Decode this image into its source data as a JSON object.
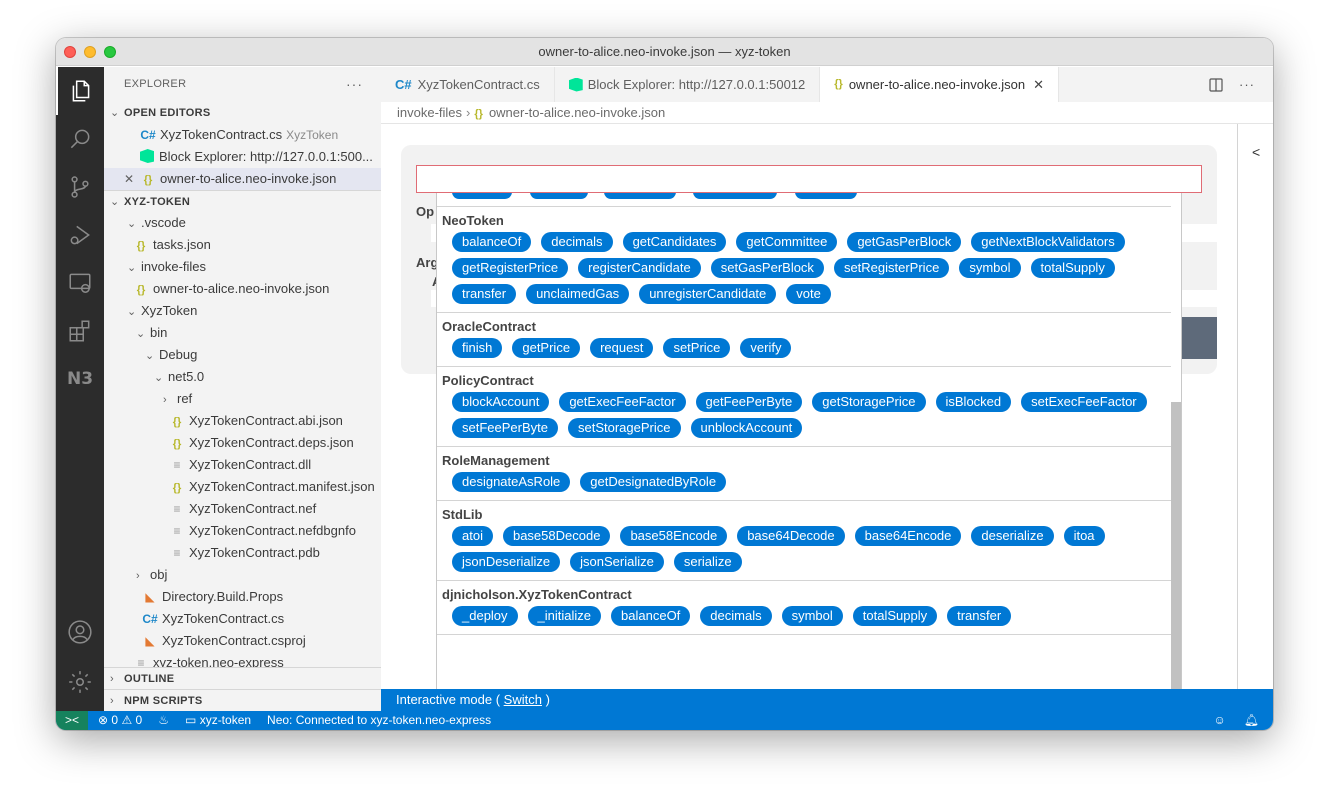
{
  "window": {
    "title": "owner-to-alice.neo-invoke.json — xyz-token"
  },
  "activity_bar": {
    "items": [
      {
        "name": "explorer",
        "icon": "files-icon",
        "active": true
      },
      {
        "name": "search",
        "icon": "search-icon"
      },
      {
        "name": "source-control",
        "icon": "source-control-icon"
      },
      {
        "name": "run-debug",
        "icon": "run-debug-icon"
      },
      {
        "name": "remote-explorer",
        "icon": "remote-explorer-icon"
      },
      {
        "name": "extensions",
        "icon": "extensions-icon"
      },
      {
        "name": "neo-n3",
        "icon": "n3-icon",
        "label": "N3"
      }
    ],
    "bottom": [
      {
        "name": "accounts",
        "icon": "account-icon"
      },
      {
        "name": "manage",
        "icon": "gear-icon"
      }
    ]
  },
  "sidebar": {
    "title": "EXPLORER",
    "more": "···",
    "open_editors": {
      "label": "OPEN EDITORS",
      "items": [
        {
          "icon": "csharp-icon",
          "name": "XyzTokenContract.cs",
          "desc": "XyzToken"
        },
        {
          "icon": "neo-icon",
          "name": "Block Explorer: http://127.0.0.1:500..."
        },
        {
          "icon": "json-icon",
          "name": "owner-to-alice.neo-invoke.json",
          "selected": true
        }
      ]
    },
    "workspace": {
      "label": "XYZ-TOKEN",
      "items": [
        {
          "depth": 1,
          "type": "folder",
          "open": true,
          "name": ".vscode"
        },
        {
          "depth": 1,
          "type": "json",
          "name": "tasks.json"
        },
        {
          "depth": 1,
          "type": "folder",
          "open": true,
          "name": "invoke-files"
        },
        {
          "depth": 1,
          "type": "json",
          "name": "owner-to-alice.neo-invoke.json"
        },
        {
          "depth": 1,
          "type": "folder",
          "open": true,
          "name": "XyzToken"
        },
        {
          "depth": 2,
          "type": "folder",
          "open": true,
          "name": "bin"
        },
        {
          "depth": 3,
          "type": "folder",
          "open": true,
          "name": "Debug"
        },
        {
          "depth": 4,
          "type": "folder",
          "open": true,
          "name": "net5.0"
        },
        {
          "depth": 5,
          "type": "folder",
          "open": false,
          "name": "ref"
        },
        {
          "depth": 5,
          "type": "json",
          "name": "XyzTokenContract.abi.json"
        },
        {
          "depth": 5,
          "type": "json",
          "name": "XyzTokenContract.deps.json"
        },
        {
          "depth": 5,
          "type": "file",
          "name": "XyzTokenContract.dll"
        },
        {
          "depth": 5,
          "type": "json",
          "name": "XyzTokenContract.manifest.json"
        },
        {
          "depth": 5,
          "type": "file",
          "name": "XyzTokenContract.nef"
        },
        {
          "depth": 5,
          "type": "file",
          "name": "XyzTokenContract.nefdbgnfo"
        },
        {
          "depth": 5,
          "type": "file",
          "name": "XyzTokenContract.pdb"
        },
        {
          "depth": 2,
          "type": "folder",
          "open": false,
          "name": "obj"
        },
        {
          "depth": 2,
          "type": "rss",
          "name": "Directory.Build.Props"
        },
        {
          "depth": 2,
          "type": "cs",
          "name": "XyzTokenContract.cs"
        },
        {
          "depth": 2,
          "type": "rss",
          "name": "XyzTokenContract.csproj"
        },
        {
          "depth": 1,
          "type": "file",
          "name": "xyz-token.neo-express"
        }
      ]
    },
    "outline_label": "OUTLINE",
    "npm_label": "NPM SCRIPTS"
  },
  "tabs": [
    {
      "icon": "csharp-icon",
      "label": "XyzTokenContract.cs"
    },
    {
      "icon": "neo-icon",
      "label": "Block Explorer: http://127.0.0.1:50012"
    },
    {
      "icon": "json-icon",
      "label": "owner-to-alice.neo-invoke.json",
      "active": true
    }
  ],
  "breadcrumb": {
    "folder": "invoke-files",
    "file": "owner-to-alice.neo-invoke.json"
  },
  "form": {
    "search_value": "",
    "operation_label_partial": "Op",
    "arguments_label_partial": "Arg",
    "arg_sublabel_partial": "A",
    "collapse_label": "<"
  },
  "dropdown": {
    "groups": [
      {
        "name": "NeoToken",
        "methods": [
          "balanceOf",
          "decimals",
          "getCandidates",
          "getCommittee",
          "getGasPerBlock",
          "getNextBlockValidators",
          "getRegisterPrice",
          "registerCandidate",
          "setGasPerBlock",
          "setRegisterPrice",
          "symbol",
          "totalSupply",
          "transfer",
          "unclaimedGas",
          "unregisterCandidate",
          "vote"
        ]
      },
      {
        "name": "OracleContract",
        "methods": [
          "finish",
          "getPrice",
          "request",
          "setPrice",
          "verify"
        ]
      },
      {
        "name": "PolicyContract",
        "methods": [
          "blockAccount",
          "getExecFeeFactor",
          "getFeePerByte",
          "getStoragePrice",
          "isBlocked",
          "setExecFeeFactor",
          "setFeePerByte",
          "setStoragePrice",
          "unblockAccount"
        ]
      },
      {
        "name": "RoleManagement",
        "methods": [
          "designateAsRole",
          "getDesignatedByRole"
        ]
      },
      {
        "name": "StdLib",
        "methods": [
          "atoi",
          "base58Decode",
          "base58Encode",
          "base64Decode",
          "base64Encode",
          "deserialize",
          "itoa",
          "jsonDeserialize",
          "jsonSerialize",
          "serialize"
        ]
      },
      {
        "name": "djnicholson.XyzTokenContract",
        "methods": [
          "_deploy",
          "_initialize",
          "balanceOf",
          "decimals",
          "symbol",
          "totalSupply",
          "transfer"
        ]
      }
    ]
  },
  "interactive_bar": {
    "prefix": "Interactive mode ( ",
    "link": "Switch",
    "suffix": " )"
  },
  "statusbar": {
    "remote_icon": "remote-icon",
    "errors": "0",
    "warnings": "0",
    "folder": "xyz-token",
    "neo_status": "Neo: Connected to xyz-token.neo-express"
  },
  "colors": {
    "accent": "#0078d4",
    "pill": "#0078d4",
    "remote": "#16825d",
    "invalid_border": "#e06c75"
  }
}
